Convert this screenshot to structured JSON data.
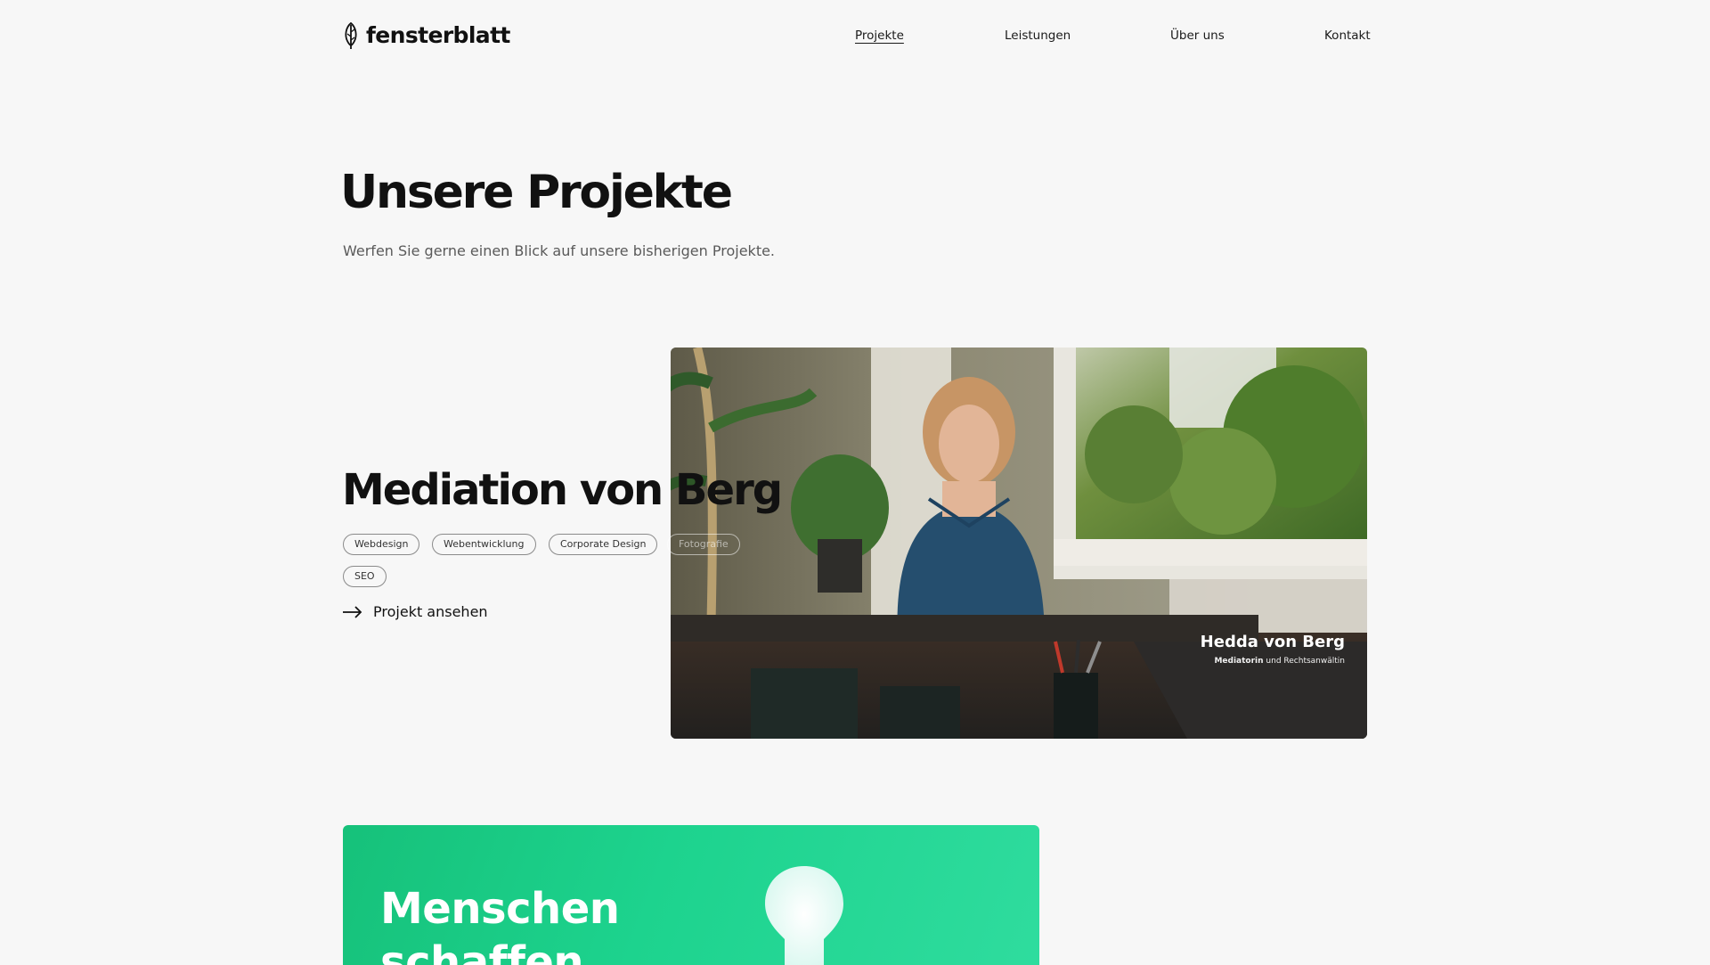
{
  "brand": {
    "name": "fensterblatt"
  },
  "nav": {
    "items": [
      {
        "label": "Projekte",
        "active": true
      },
      {
        "label": "Leistungen",
        "active": false
      },
      {
        "label": "Über uns",
        "active": false
      },
      {
        "label": "Kontakt",
        "active": false
      }
    ]
  },
  "hero": {
    "title": "Unsere Projekte",
    "subtitle": "Werfen Sie gerne einen Blick auf unsere bisherigen Projekte."
  },
  "projects": [
    {
      "title": "Mediation von Berg",
      "tags": [
        "Webdesign",
        "Webentwicklung",
        "Corporate Design",
        "Fotografie",
        "SEO"
      ],
      "link_label": "Projekt ansehen",
      "image": {
        "caption_name": "Hedda von Berg",
        "caption_role_bold": "Mediatorin",
        "caption_role_rest": "und Rechtsanwältin"
      }
    },
    {
      "image": {
        "headline": "Menschen\nschaffen"
      }
    }
  ],
  "icons": {
    "logo": "leaf-logo-icon",
    "project_link": "arrow-right-icon",
    "project2": "lightbulb-icon"
  },
  "colors": {
    "background": "#f7f7f7",
    "text": "#111111",
    "muted_text": "#5a5a5a",
    "project2_green": "#1dd38e"
  }
}
